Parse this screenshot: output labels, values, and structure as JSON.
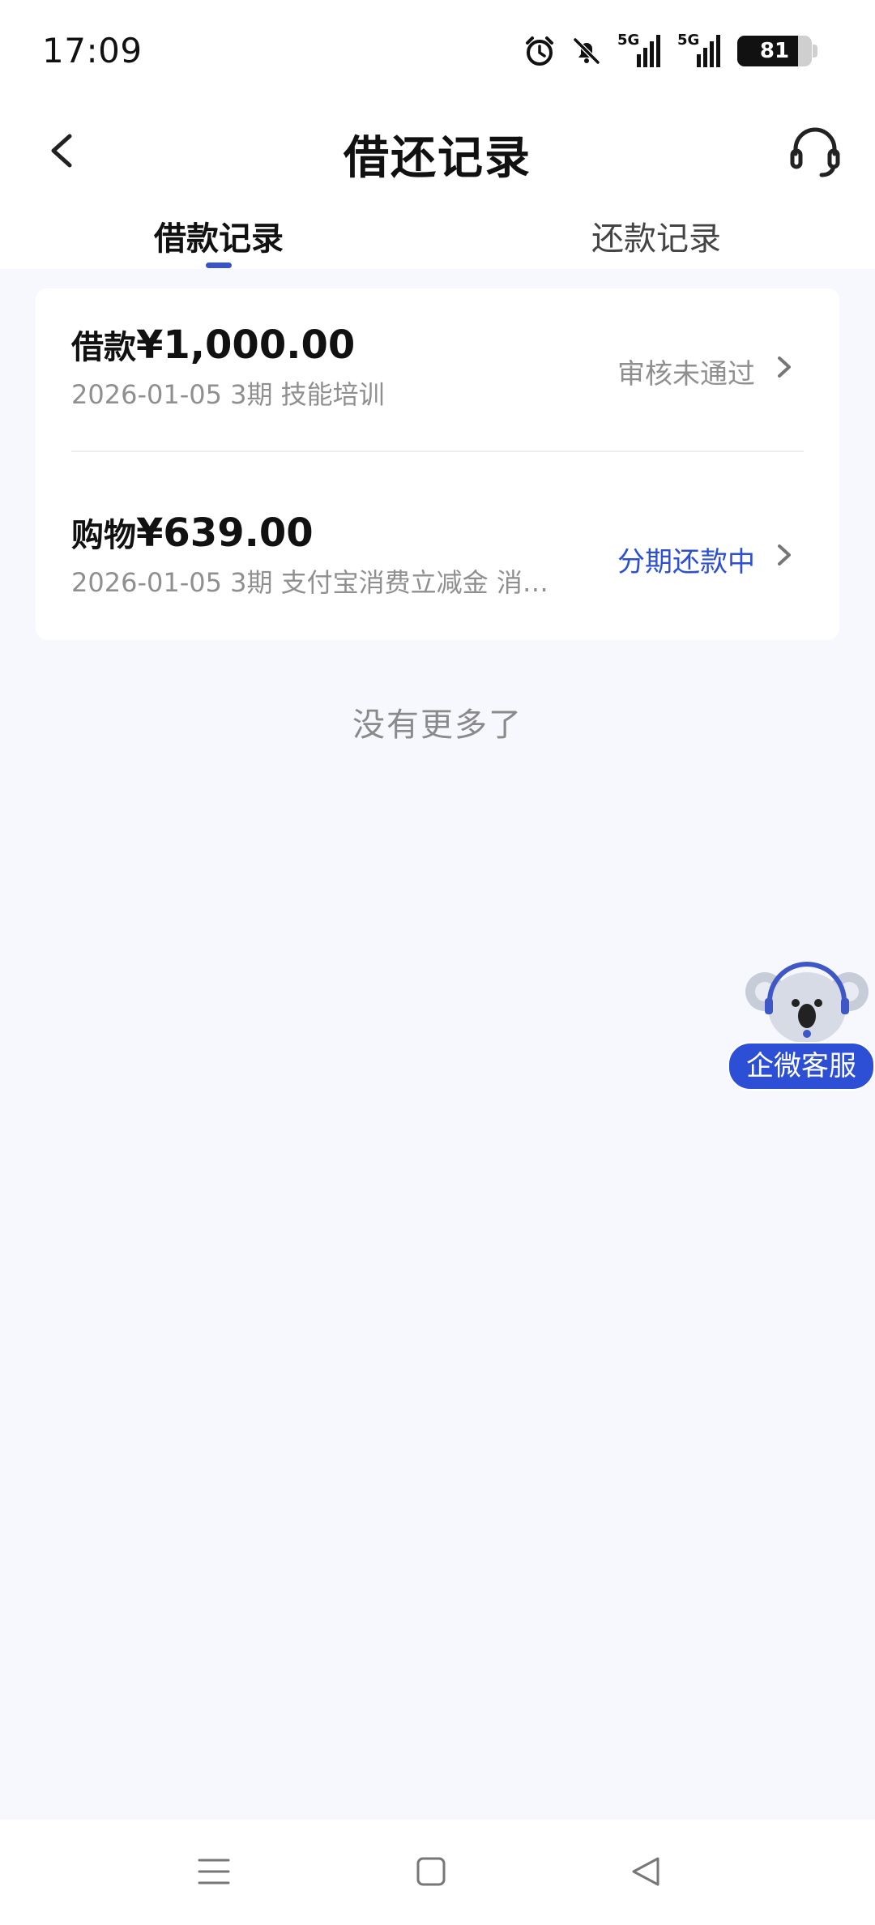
{
  "status_bar": {
    "time": "17:09",
    "network_1": "5G",
    "network_2": "5G",
    "battery": "81",
    "battery_level": 0.81,
    "icons": [
      "alarm-icon",
      "bell-off-icon",
      "signal-icon",
      "signal-icon",
      "battery-icon"
    ]
  },
  "header": {
    "title": "借还记录",
    "back_icon": "chevron-left-icon",
    "service_icon": "headset-icon"
  },
  "tabs": [
    {
      "label": "借款记录",
      "active": true
    },
    {
      "label": "还款记录",
      "active": false
    }
  ],
  "colors": {
    "accent": "#3a54c8",
    "status_active": "#2c4fd6",
    "status_muted": "#8f8f8f",
    "background": "#f7f8fd"
  },
  "records": [
    {
      "kind": "借款",
      "amount": "¥1,000.00",
      "meta": "2026-01-05 3期  技能培训",
      "status": "审核未通过"
    },
    {
      "kind": "购物",
      "amount": "¥639.00",
      "meta": "2026-01-05 3期  支付宝消费立减金 消…",
      "status": "分期还款中"
    }
  ],
  "list_footer": "没有更多了",
  "floating_service": {
    "label": "企微客服",
    "icon": "koala-mascot-icon"
  },
  "nav_bar": {
    "icons": [
      "menu-icon",
      "home-square-icon",
      "back-triangle-icon"
    ]
  }
}
